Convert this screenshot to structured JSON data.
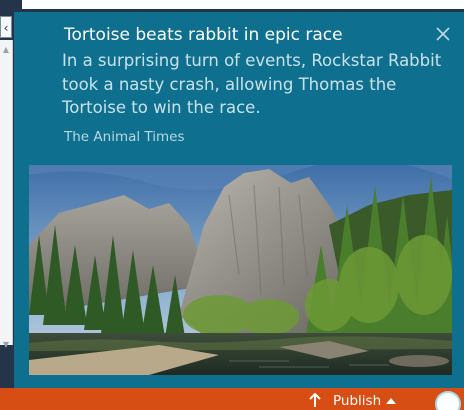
{
  "toast": {
    "title": "Tortoise beats rabbit in epic race",
    "body": "In a surprising turn of events, Rockstar Rabbit took a nasty crash, allowing Thomas the Tortoise to win the race.",
    "source": "The Animal Times",
    "close_icon": "close-icon",
    "image": "mountain-valley-river-landscape"
  },
  "taskbar": {
    "publish_label": "Publish",
    "publish_icon": "up-arrow-icon",
    "caret_icon": "caret-up-icon",
    "status_icon": "status-circle-icon"
  },
  "background_window": {
    "collapse_icon": "chevron-left-icon",
    "scroll_up_icon": "scroll-up-icon",
    "scroll_down_icon": "scroll-down-icon"
  },
  "colors": {
    "toast_background": "#0f6f8f",
    "taskbar_background": "#d74e14",
    "title_text": "#ffffff",
    "body_text": "#c9e2ea"
  }
}
